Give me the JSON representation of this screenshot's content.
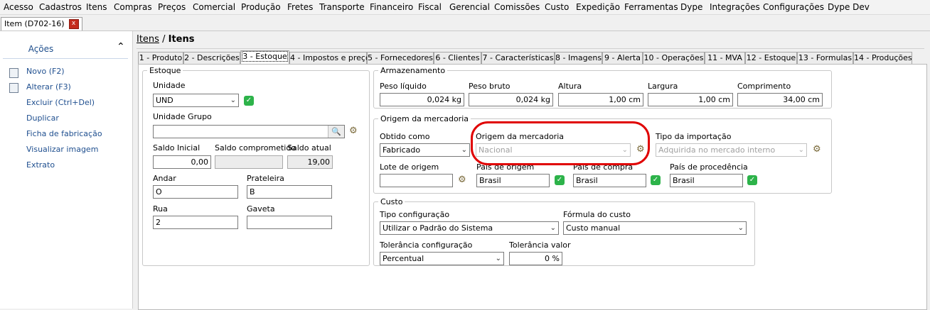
{
  "menu": [
    "Acesso",
    "Cadastros",
    "Itens",
    "Compras",
    "Preços",
    "Comercial",
    "Produção",
    "Fretes",
    "Transporte",
    "Financeiro",
    "Fiscal",
    "Gerencial",
    "Comissões",
    "Custo",
    "Expedição",
    "Ferramentas",
    "Dype",
    "Integrações",
    "Configurações",
    "Dype Dev"
  ],
  "doc_tab": {
    "label": "Item (D702-16)",
    "close": "x"
  },
  "sidebar": {
    "title": "Ações",
    "actions": [
      "Novo (F2)",
      "Alterar (F3)",
      "Excluir (Ctrl+Del)",
      "Duplicar",
      "Ficha de fabricação",
      "Visualizar imagem",
      "Extrato"
    ]
  },
  "breadcrumb": {
    "root": "Itens",
    "sep": " / ",
    "current": "Itens"
  },
  "tabs": [
    "1 - Produto",
    "2 - Descrições",
    "3 - Estoque",
    "4 - Impostos e preço",
    "5 - Fornecedores",
    "6 - Clientes",
    "7 - Características",
    "8 - Imagens",
    "9 - Alerta",
    "10 - Operações",
    "11 - MVA",
    "12 - Estoque",
    "13 - Formulas",
    "14 - Produções"
  ],
  "estoque": {
    "legend": "Estoque",
    "unidade": {
      "label": "Unidade",
      "value": "UND"
    },
    "unidade_grupo": {
      "label": "Unidade Grupo",
      "value": ""
    },
    "saldo_inicial": {
      "label": "Saldo Inicial",
      "value": "0,00"
    },
    "saldo_comprometido": {
      "label": "Saldo comprometido",
      "value": ""
    },
    "saldo_atual": {
      "label": "Saldo atual",
      "value": "19,00"
    },
    "andar": {
      "label": "Andar",
      "value": "O"
    },
    "prateleira": {
      "label": "Prateleira",
      "value": "B"
    },
    "rua": {
      "label": "Rua",
      "value": "2"
    },
    "gaveta": {
      "label": "Gaveta",
      "value": ""
    }
  },
  "armazenamento": {
    "legend": "Armazenamento",
    "peso_liquido": {
      "label": "Peso líquido",
      "value": "0,024 kg"
    },
    "peso_bruto": {
      "label": "Peso bruto",
      "value": "0,024 kg"
    },
    "altura": {
      "label": "Altura",
      "value": "1,00 cm"
    },
    "largura": {
      "label": "Largura",
      "value": "1,00 cm"
    },
    "comprimento": {
      "label": "Comprimento",
      "value": "34,00 cm"
    }
  },
  "origem": {
    "legend": "Origem da mercadoria",
    "obtido_como": {
      "label": "Obtido como",
      "value": "Fabricado"
    },
    "origem_mercadoria": {
      "label": "Origem da mercadoria",
      "value": "Nacional"
    },
    "tipo_importacao": {
      "label": "Tipo da importação",
      "value": "Adquirida no mercado interno"
    },
    "lote_origem": {
      "label": "Lote de origem",
      "value": ""
    },
    "pais_origem": {
      "label": "País de origem",
      "value": "Brasil"
    },
    "pais_compra": {
      "label": "País de compra",
      "value": "Brasil"
    },
    "pais_procedencia": {
      "label": "País de procedência",
      "value": "Brasil"
    }
  },
  "custo": {
    "legend": "Custo",
    "tipo_config": {
      "label": "Tipo configuração",
      "value": "Utilizar o Padrão do Sistema"
    },
    "formula": {
      "label": "Fórmula do custo",
      "value": "Custo manual"
    },
    "tolerancia_config": {
      "label": "Tolerância configuração",
      "value": "Percentual"
    },
    "tolerancia_valor": {
      "label": "Tolerância valor",
      "value": "0 %"
    }
  },
  "colors": {
    "accent": "#1f4f8f",
    "highlight": "#e00000",
    "check": "#2db34a",
    "close": "#c42b1c"
  },
  "icons": {
    "check": "check-icon",
    "lookup": "lookup-icon",
    "binoculars": "binoculars-icon",
    "chevron": "chevron-down-icon"
  }
}
